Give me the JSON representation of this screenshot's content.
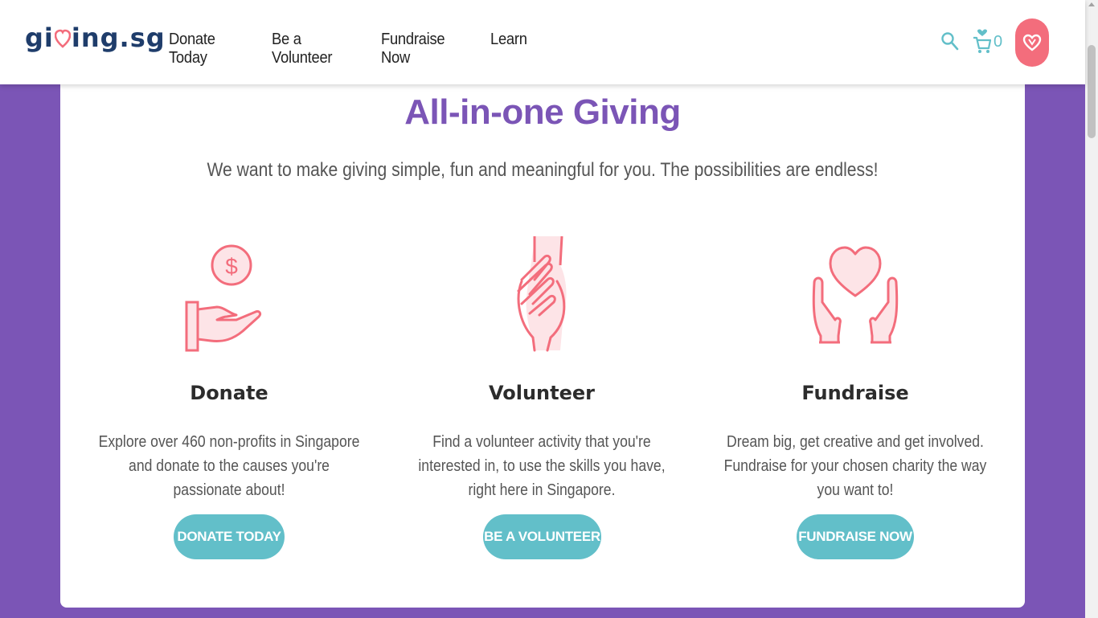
{
  "header": {
    "logo": "giving.sg",
    "logo_parts": [
      "gi",
      "ing.sg"
    ],
    "nav": [
      "Donate Today",
      "Be a Volunteer",
      "Fundraise Now",
      "Learn"
    ],
    "cart_count": "0"
  },
  "main": {
    "title": "All-in-one Giving",
    "subtitle": "We want to make giving simple, fun and meaningful for you. The possibilities are endless!",
    "columns": [
      {
        "icon": "hand-coin-icon",
        "title": "Donate",
        "description": "Explore over 460 non-profits in Singapore and donate to the causes you're passionate about!",
        "button": "DONATE TODAY"
      },
      {
        "icon": "handshake-icon",
        "title": "Volunteer",
        "description": "Find a volunteer activity that you're interested in, to use the skills you have, right here in Singapore.",
        "button": "BE A VOLUNTEER"
      },
      {
        "icon": "hands-heart-icon",
        "title": "Fundraise",
        "description": "Dream big, get creative and get involved. Fundraise for your chosen charity the way you want to!",
        "button": "FUNDRAISE NOW"
      }
    ]
  },
  "colors": {
    "brand_purple": "#7b55b6",
    "accent_teal": "#62bfc9",
    "accent_pink": "#f36d7c",
    "logo_navy": "#1f3d6b"
  }
}
